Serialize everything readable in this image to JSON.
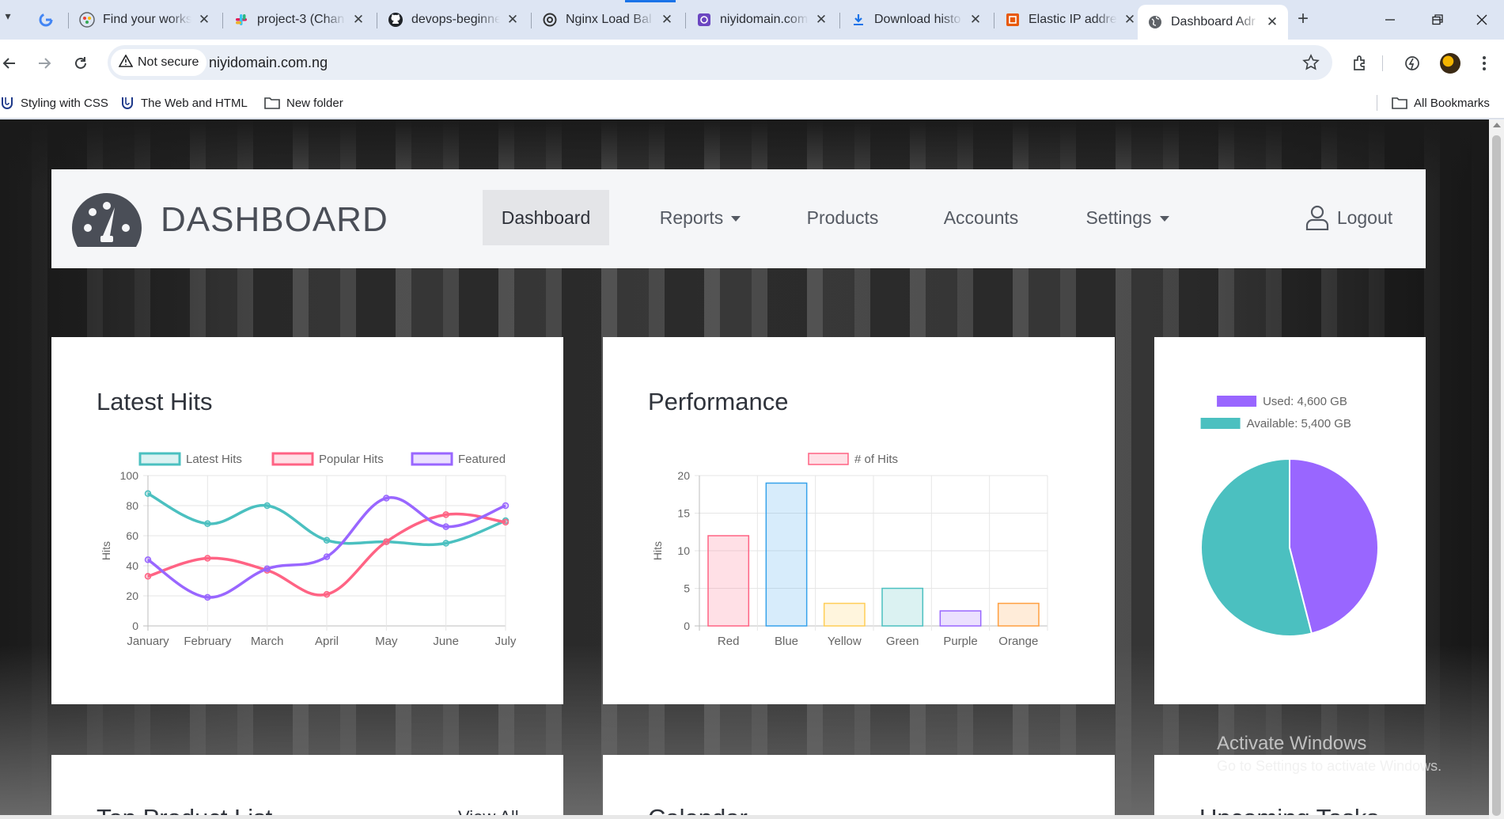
{
  "browser": {
    "tabs": [
      {
        "title": "Find your works",
        "icon": "workspace-icon"
      },
      {
        "title": "project-3 (Chan",
        "icon": "slack-icon"
      },
      {
        "title": "devops-beginne",
        "icon": "github-icon"
      },
      {
        "title": "Nginx Load Bal",
        "icon": "openai-icon"
      },
      {
        "title": "niyidomain.com",
        "icon": "domain-icon"
      },
      {
        "title": "Download histo",
        "icon": "download-icon"
      },
      {
        "title": "Elastic IP addre",
        "icon": "aws-icon"
      },
      {
        "title": "Dashboard Adr",
        "icon": "globe-icon"
      }
    ],
    "security_label": "Not secure",
    "url": "niyidomain.com.ng",
    "bookmarks": [
      "Styling with CSS",
      "The Web and HTML",
      "New folder"
    ],
    "all_bookmarks": "All Bookmarks"
  },
  "navbar": {
    "brand": "DASHBOARD",
    "items": [
      {
        "label": "Dashboard",
        "active": true
      },
      {
        "label": "Reports",
        "dropdown": true
      },
      {
        "label": "Products"
      },
      {
        "label": "Accounts"
      },
      {
        "label": "Settings",
        "dropdown": true
      }
    ],
    "logout": "Logout"
  },
  "cards": {
    "latest_hits_title": "Latest Hits",
    "performance_title": "Performance",
    "top_product_title": "Top Product List",
    "view_all": "View All",
    "calendar_title": "Calendar",
    "upcoming_title": "Upcoming Tasks"
  },
  "chart_data": [
    {
      "type": "line",
      "categories": [
        "January",
        "February",
        "March",
        "April",
        "May",
        "June",
        "July"
      ],
      "ylabel": "Hits",
      "ylim": [
        0,
        100
      ],
      "yticks": [
        0,
        20,
        40,
        60,
        80,
        100
      ],
      "grid": true,
      "legend": "top",
      "series": [
        {
          "name": "Latest Hits",
          "values": [
            88,
            68,
            80,
            57,
            56,
            55,
            70
          ],
          "color": "#4bc0c0"
        },
        {
          "name": "Popular Hits",
          "values": [
            33,
            45,
            37,
            21,
            56,
            74,
            69
          ],
          "color": "#ff6384"
        },
        {
          "name": "Featured",
          "values": [
            44,
            19,
            38,
            46,
            85,
            66,
            80
          ],
          "color": "#9966ff"
        }
      ]
    },
    {
      "type": "bar",
      "categories": [
        "Red",
        "Blue",
        "Yellow",
        "Green",
        "Purple",
        "Orange"
      ],
      "series": [
        {
          "name": "# of Hits",
          "values": [
            12,
            19,
            3,
            5,
            2,
            3
          ]
        }
      ],
      "colors": [
        "#ff6384",
        "#36a2eb",
        "#ffce56",
        "#4bc0c0",
        "#9966ff",
        "#ff9f40"
      ],
      "ylabel": "Hits",
      "ylim": [
        0,
        20
      ],
      "yticks": [
        0,
        5,
        10,
        15,
        20
      ],
      "grid": true,
      "legend": "top"
    },
    {
      "type": "pie",
      "categories": [
        "Used: 4,600 GB",
        "Available: 5,400 GB"
      ],
      "values": [
        4600,
        5400
      ],
      "colors": [
        "#9966ff",
        "#4bc0c0"
      ],
      "legend": "top"
    }
  ],
  "watermark": {
    "title": "Activate Windows",
    "subtitle": "Go to Settings to activate Windows."
  }
}
